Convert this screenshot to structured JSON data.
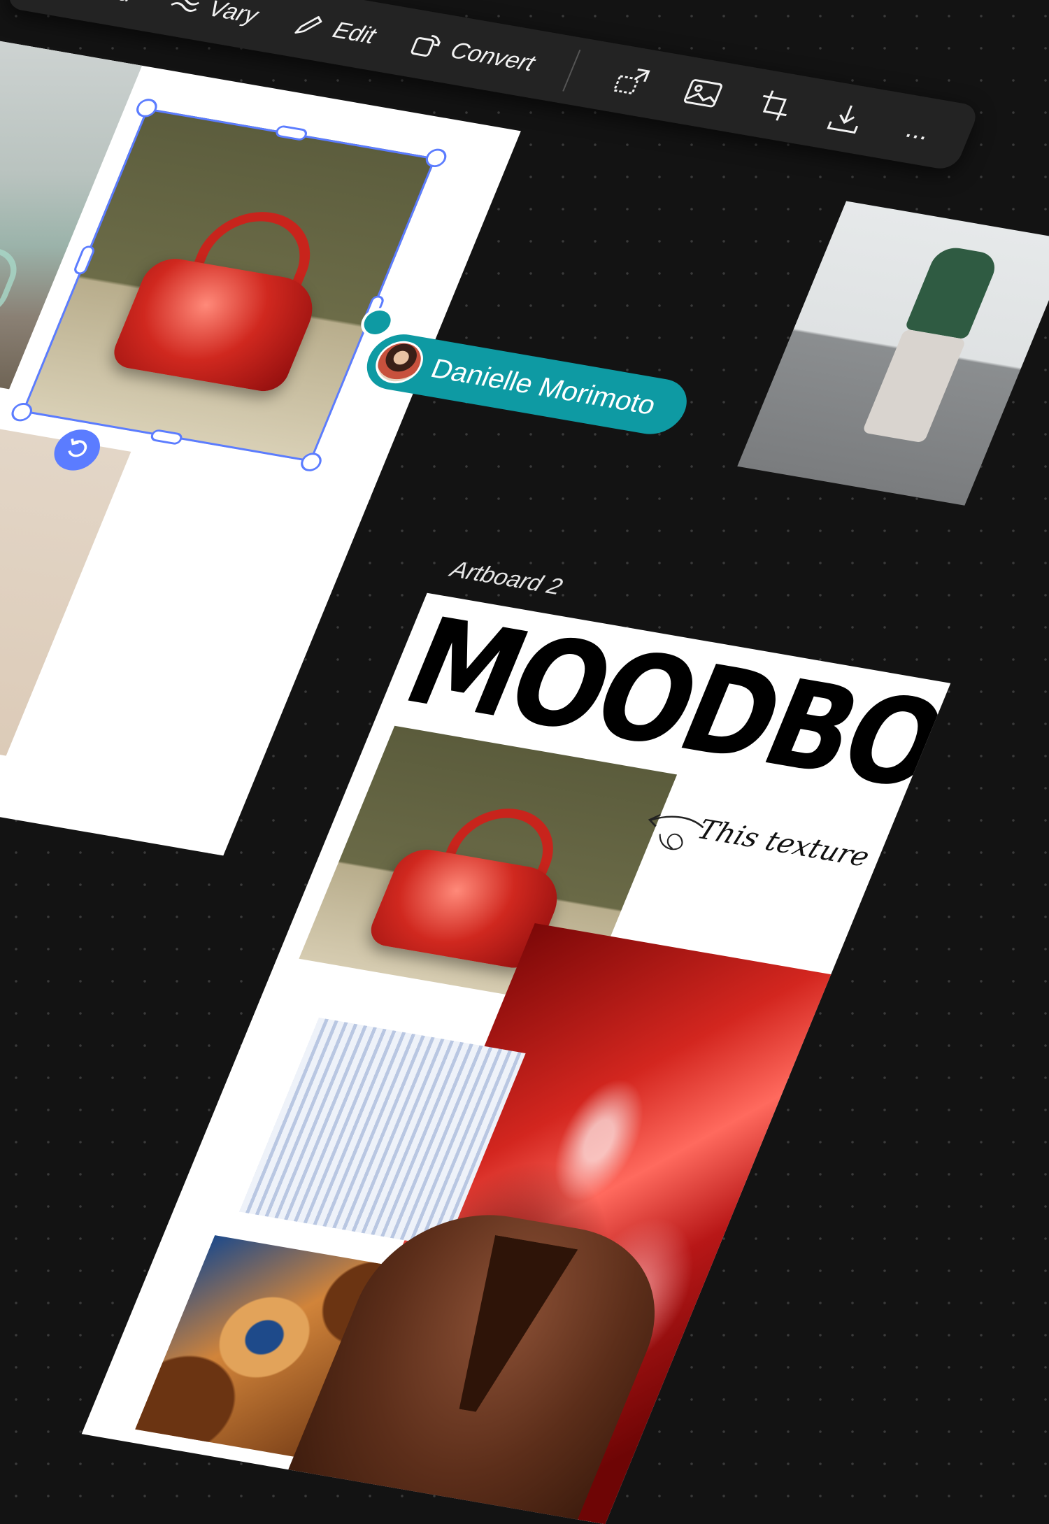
{
  "toolbar": {
    "load_label": "Load",
    "vary_label": "Vary",
    "edit_label": "Edit",
    "convert_label": "Convert",
    "tools": [
      "expand-icon",
      "image-icon",
      "crop-icon",
      "download-icon",
      "more-icon"
    ],
    "more_label": "..."
  },
  "collaborator": {
    "name": "Danielle Morimoto",
    "color": "#0e9aa3"
  },
  "selection": {
    "color": "#5b7cff"
  },
  "artboard2": {
    "label": "Artboard 2",
    "title": "MOODBOARD",
    "note": "This texture"
  }
}
